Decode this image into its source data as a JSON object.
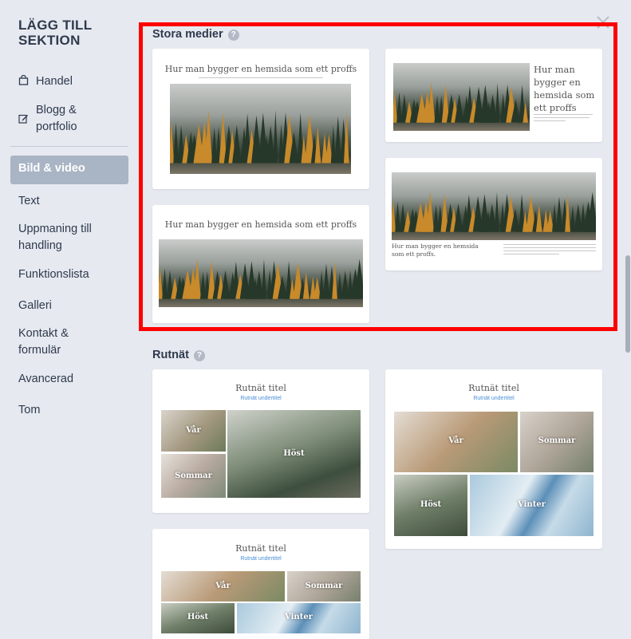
{
  "sidebar": {
    "title": "LÄGG TILL SEKTION",
    "items": [
      {
        "label": "Handel",
        "icon": "shopping-bag-icon"
      },
      {
        "label": "Blogg & portfolio",
        "icon": "edit-icon"
      },
      {
        "label": "Bild & video",
        "active": true
      },
      {
        "label": "Text"
      },
      {
        "label": "Uppmaning till handling"
      },
      {
        "label": "Funktionslista"
      },
      {
        "label": "Galleri"
      },
      {
        "label": "Kontakt & formulär"
      },
      {
        "label": "Avancerad"
      },
      {
        "label": "Tom"
      }
    ]
  },
  "sections": {
    "large_media": {
      "title": "Stora medier",
      "card_heading": "Hur man bygger en hemsida som ett proffs",
      "card_side_heading": "Hur man bygger en hemsida som ett proffs",
      "card_caption": "Hur man bygger en hemsida som ett proffs."
    },
    "grid": {
      "title": "Rutnät",
      "card_title": "Rutnät titel",
      "card_subtitle": "Rutnät undertitel",
      "labels": {
        "spring": "Vår",
        "summer": "Sommar",
        "autumn": "Höst",
        "winter": "Vinter"
      }
    }
  },
  "colors": {
    "highlight_border": "#ff0000",
    "active_item_bg": "#a9b4c4",
    "subtitle_link": "#4a8fd8"
  }
}
